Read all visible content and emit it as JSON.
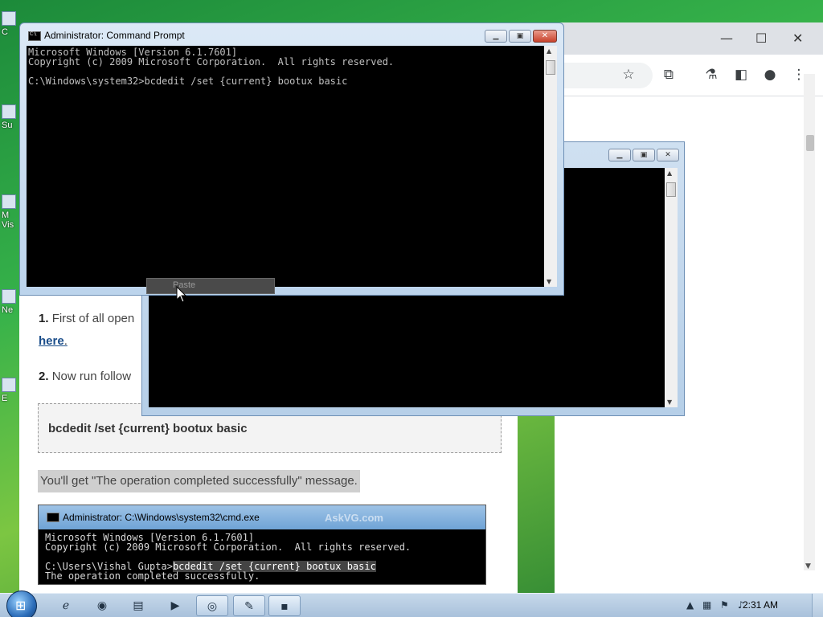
{
  "desktop": {
    "icons": [
      {
        "label": "C",
        "name": "desktop-icon-computer"
      },
      {
        "label": "Su",
        "name": "desktop-icon-su"
      },
      {
        "label": "M\nVis",
        "name": "desktop-icon-msvisual"
      },
      {
        "label": "Ne",
        "name": "desktop-icon-network"
      },
      {
        "label": "E",
        "name": "desktop-icon-e"
      }
    ]
  },
  "browser": {
    "window_controls": {
      "minimize": "—",
      "maximize": "☐",
      "close": "✕"
    },
    "toolbar_icons": [
      "star-icon",
      "extensions-icon",
      "labs-icon",
      "sidepanel-icon",
      "profile-icon",
      "menu-icon"
    ]
  },
  "article": {
    "step1_num": "1.",
    "step1_text": "First of all open",
    "step1_link": "here",
    "step1_end": ".",
    "step2_num": "2.",
    "step2_text": "Now run follow",
    "code": "bcdedit /set {current} bootux basic",
    "message": "You'll get \"The operation completed successfully\" message.",
    "screenshot": {
      "title": "Administrator: C:\\Windows\\system32\\cmd.exe",
      "watermark": "AskVG.com",
      "line1": "Microsoft Windows [Version 6.1.7601]",
      "line2": "Copyright (c) 2009 Microsoft Corporation.  All rights reserved.",
      "prompt": "C:\\Users\\Vishal Gupta>",
      "command": "bcdedit /set {current} bootux basic",
      "result": "The operation completed successfully."
    }
  },
  "cmd_main": {
    "title": "Administrator:  Command Prompt",
    "line1": "Microsoft Windows [Version 6.1.7601]",
    "line2": "Copyright (c) 2009 Microsoft Corporation.  All rights reserved.",
    "line3": "",
    "line4": "C:\\Windows\\system32>bcdedit /set {current} bootux basic"
  },
  "context_menu": {
    "item": "Paste"
  },
  "taskbar": {
    "clock": "2:31 AM",
    "items": [
      "ie-icon",
      "firefox-icon",
      "explorer-icon",
      "media-icon",
      "app-icon",
      "tool-icon",
      "cmd-icon"
    ]
  }
}
